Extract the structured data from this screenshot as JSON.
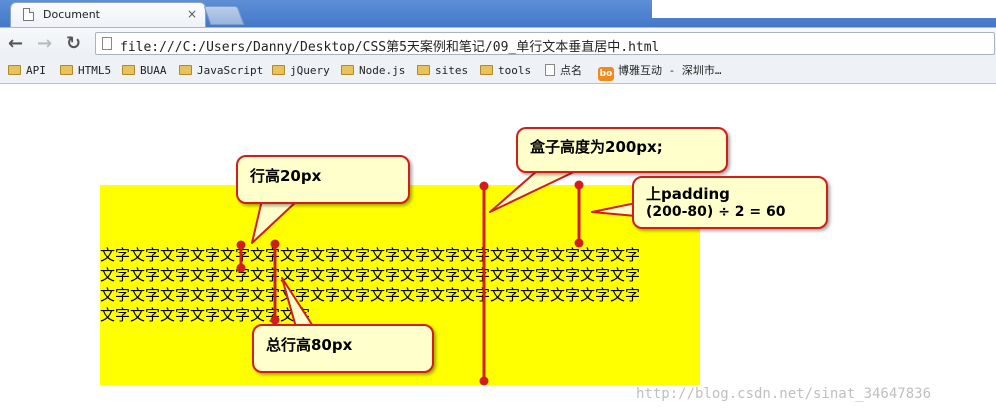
{
  "browser": {
    "tab_title": "Document",
    "tab_close": "×",
    "nav_back": "←",
    "nav_forward": "→",
    "nav_reload": "↻",
    "url": "file:///C:/Users/Danny/Desktop/CSS第5天案例和笔记/09_单行文本垂直居中.html",
    "bookmarks": [
      {
        "label": "API",
        "icon": "folder-icon"
      },
      {
        "label": "HTML5",
        "icon": "folder-icon"
      },
      {
        "label": "BUAA",
        "icon": "folder-icon"
      },
      {
        "label": "JavaScript",
        "icon": "folder-icon"
      },
      {
        "label": "jQuery",
        "icon": "folder-icon"
      },
      {
        "label": "Node.js",
        "icon": "folder-icon"
      },
      {
        "label": "sites",
        "icon": "folder-icon"
      },
      {
        "label": "tools",
        "icon": "folder-icon"
      },
      {
        "label": "点名",
        "icon": "page-icon"
      },
      {
        "label": "博雅互动 - 深圳市…",
        "icon": "boyaa-logo-icon"
      }
    ]
  },
  "demo": {
    "box_color": "#ffff00",
    "text_lines": [
      "文字文字文字文字文字文字文字文字文字文字文字文字文字文字文字文字文字文字",
      "文字文字文字文字文字文字文字文字文字文字文字文字文字文字文字文字文字文字",
      "文字文字文字文字文字文字文字文字文字文字文字文字文字文字文字文字文字文字",
      "文字文字文字文字文字文字文字"
    ]
  },
  "annotations": {
    "line_height": "行高20px",
    "total_line_height": "总行高80px",
    "box_height": "盒子高度为200px;",
    "padding_line1": "上padding",
    "padding_line2": "(200-80) ÷ 2 = 60",
    "accent_color": "#d21d1d",
    "callout_bg": "#ffffcc"
  },
  "watermark": "http://blog.csdn.net/sinat_34647836"
}
